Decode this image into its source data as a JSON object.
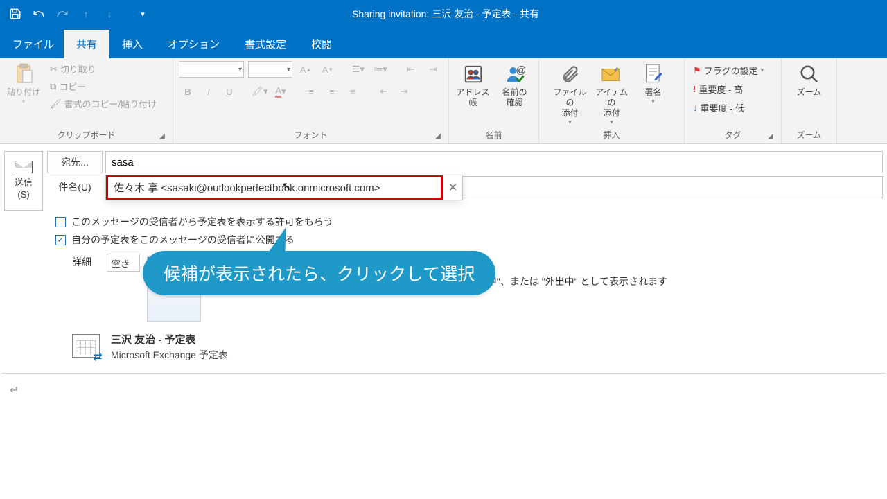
{
  "titlebar": {
    "title": "Sharing invitation: 三沢 友治 - 予定表 - 共有"
  },
  "tabs": {
    "file": "ファイル",
    "share": "共有",
    "insert": "挿入",
    "options": "オプション",
    "format": "書式設定",
    "review": "校閲"
  },
  "ribbon": {
    "clipboard": {
      "label": "クリップボード",
      "paste": "貼り付け",
      "cut": "切り取り",
      "copy": "コピー",
      "format_painter": "書式のコピー/貼り付け"
    },
    "font": {
      "label": "フォント"
    },
    "names": {
      "label": "名前",
      "address_book": "アドレス帳",
      "check_names": "名前の\n確認"
    },
    "include": {
      "label": "挿入",
      "attach_file": "ファイルの\n添付",
      "attach_item": "アイテムの\n添付",
      "signature": "署名"
    },
    "tags": {
      "label": "タグ",
      "flag": "フラグの設定",
      "hi": "重要度 - 高",
      "lo": "重要度 - 低"
    },
    "zoom": {
      "label": "ズーム",
      "zoom": "ズーム"
    }
  },
  "compose": {
    "send": "送信\n(S)",
    "to_button": "宛先...",
    "subject_label": "件名(U)",
    "to_value": "sasa",
    "subject_value": "",
    "ac_text": "佐々木 享  <sasaki@outlookperfectbook.onmicrosoft.com>"
  },
  "checks": {
    "request": "このメッセージの受信者から予定表を表示する許可をもらう",
    "allow": "自分の予定表をこのメッセージの受信者に公開する"
  },
  "detail": {
    "label": "詳細",
    "combo": "空き",
    "text": "時間は、\"空き時間\"、\"予定あり\"、\"仮の予定\"、\"他の場所で作業中\"、または \"外出中\" として表示されます"
  },
  "calendar_item": {
    "title": "三沢 友治 - 予定表",
    "subtitle": "Microsoft Exchange 予定表"
  },
  "callout": "候補が表示されたら、クリックして選択",
  "colors": {
    "brand": "#0072c6",
    "callout": "#1f99c8",
    "highlight": "#c00"
  }
}
